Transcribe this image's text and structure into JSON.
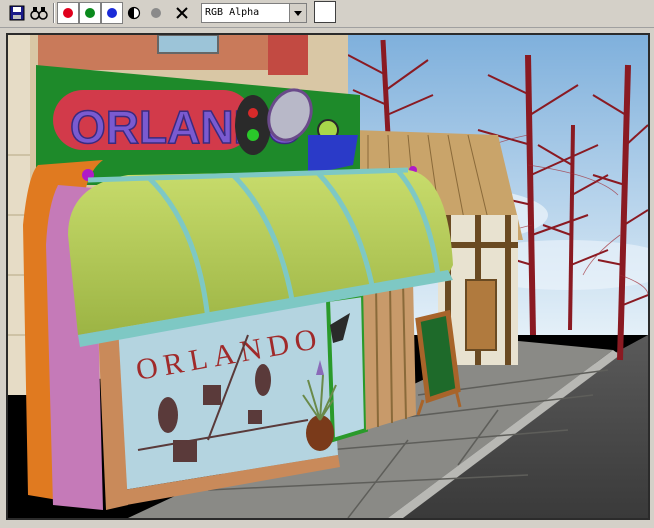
{
  "toolbar": {
    "save_icon": "floppy-disk-icon",
    "clone_icon": "binoculars-icon",
    "channels": [
      {
        "name": "red-channel",
        "color": "#e0001c"
      },
      {
        "name": "green-channel",
        "color": "#0a8a1c"
      },
      {
        "name": "blue-channel",
        "color": "#1a2ad8"
      }
    ],
    "alpha_icon": "half-circle-icon",
    "mono_icon": "gray-dot-icon",
    "clear_icon": "x-icon",
    "channel_select": {
      "value": "RGB Alpha"
    },
    "swatch_color": "#ffffff"
  },
  "render": {
    "sign_text": "ORLANDO",
    "window_text": "ORLANDO",
    "colors": {
      "sky": "#9ec8e6",
      "awning": "#b4cc58",
      "awning_trim": "#7ec8c4",
      "sign_letters": "#7a5ad0",
      "sign_board": "#1e8a2a",
      "wall": "#d9c7a5",
      "road": "#6e6e6e",
      "sidewalk": "#8a8a86",
      "tree": "#8a1a22"
    }
  }
}
